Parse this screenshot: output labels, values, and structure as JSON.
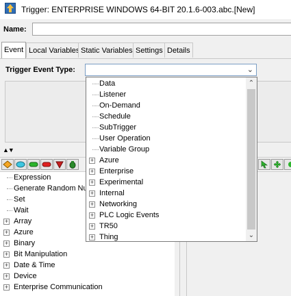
{
  "window": {
    "title": "Trigger:  ENTERPRISE WINDOWS 64-BIT 20.1.6-003.abc.[New]",
    "icon": "trigger-app-icon"
  },
  "form": {
    "name_label": "Name:",
    "name_value": ""
  },
  "tabs": [
    {
      "label": "Event",
      "active": true
    },
    {
      "label": "Local Variables",
      "active": false
    },
    {
      "label": "Static Variables",
      "active": false
    },
    {
      "label": "Settings",
      "active": false
    },
    {
      "label": "Details",
      "active": false
    }
  ],
  "trigger_event": {
    "label": "Trigger Event Type:",
    "selected": "",
    "options": [
      {
        "label": "Data",
        "expandable": false
      },
      {
        "label": "Listener",
        "expandable": false
      },
      {
        "label": "On-Demand",
        "expandable": false
      },
      {
        "label": "Schedule",
        "expandable": false
      },
      {
        "label": "SubTrigger",
        "expandable": false
      },
      {
        "label": "User Operation",
        "expandable": false
      },
      {
        "label": "Variable Group",
        "expandable": false
      },
      {
        "label": "Azure",
        "expandable": true
      },
      {
        "label": "Enterprise",
        "expandable": true
      },
      {
        "label": "Experimental",
        "expandable": true
      },
      {
        "label": "Internal",
        "expandable": true
      },
      {
        "label": "Networking",
        "expandable": true
      },
      {
        "label": "PLC Logic Events",
        "expandable": true
      },
      {
        "label": "TR50",
        "expandable": true
      },
      {
        "label": "Thing",
        "expandable": true
      }
    ]
  },
  "toolbar": {
    "shapes": [
      {
        "icon": "orange-diamond-icon",
        "color": "#f5a623"
      },
      {
        "icon": "cyan-ellipse-icon",
        "color": "#3ec6e0"
      },
      {
        "icon": "green-rounded-rect-icon",
        "color": "#2db52d"
      },
      {
        "icon": "red-rounded-rect-icon",
        "color": "#e02020"
      },
      {
        "icon": "red-triangle-down-icon",
        "color": "#c81e1e"
      },
      {
        "icon": "green-bag-icon",
        "color": "#2a8a2a"
      }
    ],
    "right_tools": [
      {
        "icon": "green-pointer-icon"
      },
      {
        "icon": "green-move-icon"
      }
    ]
  },
  "actions_tree": [
    {
      "label": "Expression",
      "expandable": false
    },
    {
      "label": "Generate Random Nu",
      "expandable": false
    },
    {
      "label": "Set",
      "expandable": false
    },
    {
      "label": "Wait",
      "expandable": false
    },
    {
      "label": "Array",
      "expandable": true
    },
    {
      "label": "Azure",
      "expandable": true
    },
    {
      "label": "Binary",
      "expandable": true
    },
    {
      "label": "Bit Manipulation",
      "expandable": true
    },
    {
      "label": "Date & Time",
      "expandable": true
    },
    {
      "label": "Device",
      "expandable": true
    },
    {
      "label": "Enterprise Communication",
      "expandable": true
    }
  ]
}
